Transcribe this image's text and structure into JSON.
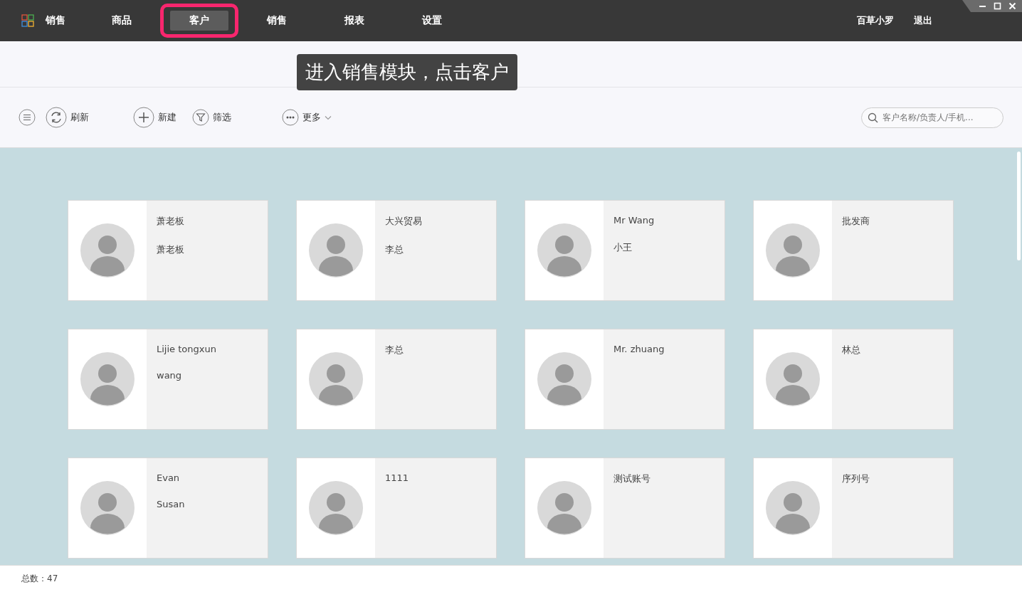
{
  "app": {
    "title": "销售"
  },
  "nav": [
    {
      "label": "商品",
      "selected": false,
      "highlighted": false
    },
    {
      "label": "客户",
      "selected": true,
      "highlighted": true
    },
    {
      "label": "销售",
      "selected": false,
      "highlighted": false
    },
    {
      "label": "报表",
      "selected": false,
      "highlighted": false
    },
    {
      "label": "设置",
      "selected": false,
      "highlighted": false
    }
  ],
  "user": {
    "name": "百草小罗",
    "logout": "退出"
  },
  "tooltip": "进入销售模块，点击客户",
  "toolbar": [
    {
      "kind": "menu"
    },
    {
      "kind": "refresh",
      "label": "刷新"
    },
    {
      "kind": "add",
      "label": "新建"
    },
    {
      "kind": "filter",
      "label": "筛选"
    },
    {
      "kind": "more",
      "label": "更多"
    }
  ],
  "search": {
    "placeholder": "客户名称/负责人/手机..."
  },
  "customers": [
    {
      "name": "萧老板",
      "contact": "萧老板"
    },
    {
      "name": "大兴贸易",
      "contact": "李总"
    },
    {
      "name": "Mr Wang",
      "contact": "小王"
    },
    {
      "name": "批发商"
    },
    {
      "name": "Lijie tongxun",
      "contact": "wang"
    },
    {
      "name": "李总"
    },
    {
      "name": "Mr. zhuang"
    },
    {
      "name": "林总"
    },
    {
      "name": "Evan",
      "contact": "Susan"
    },
    {
      "name": "1111"
    },
    {
      "name": "测试账号"
    },
    {
      "name": "序列号"
    }
  ],
  "status_bar": {
    "total": "总数：47"
  }
}
